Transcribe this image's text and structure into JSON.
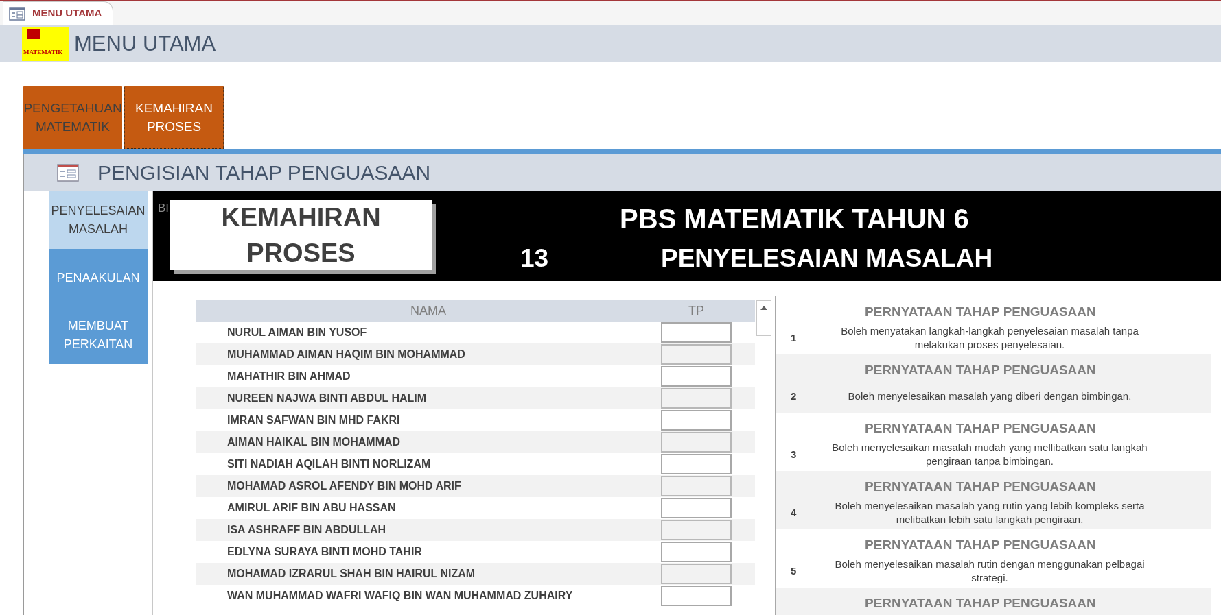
{
  "document_tab": {
    "title": "MENU UTAMA"
  },
  "header": {
    "logo_text": "MATEMATIK",
    "title": "MENU UTAMA"
  },
  "main_tabs": [
    {
      "label": "PENGETAHUAN MATEMATIK",
      "selected": false
    },
    {
      "label": "KEMAHIRAN PROSES",
      "selected": true
    }
  ],
  "section": {
    "title": "PENGISIAN TAHAP PENGUASAAN"
  },
  "sidebar": {
    "items": [
      {
        "label": "PENYELESAIAN MASALAH",
        "selected": true
      },
      {
        "label": "PENAAKULAN",
        "selected": false
      },
      {
        "label": "MEMBUAT PERKAITAN",
        "selected": false
      }
    ]
  },
  "banner": {
    "corner_text": "BI",
    "card_title": "KEMAHIRAN PROSES",
    "title": "PBS MATEMATIK TAHUN 6",
    "number": "13",
    "subtitle": "PENYELESAIAN MASALAH"
  },
  "table": {
    "columns": [
      "NAMA",
      "TP"
    ],
    "rows": [
      {
        "name": "NURUL AIMAN BIN YUSOF"
      },
      {
        "name": "MUHAMMAD AIMAN HAQIM BIN MOHAMMAD"
      },
      {
        "name": "MAHATHIR BIN AHMAD"
      },
      {
        "name": "NUREEN NAJWA BINTI ABDUL HALIM"
      },
      {
        "name": "IMRAN SAFWAN BIN MHD FAKRI"
      },
      {
        "name": "AIMAN HAIKAL BIN MOHAMMAD"
      },
      {
        "name": "SITI NADIAH AQILAH BINTI NORLIZAM"
      },
      {
        "name": "MOHAMAD ASROL AFENDY BIN MOHD ARIF"
      },
      {
        "name": "AMIRUL ARIF BIN ABU HASSAN"
      },
      {
        "name": "ISA ASHRAFF BIN ABDULLAH"
      },
      {
        "name": "EDLYNA SURAYA BINTI MOHD TAHIR"
      },
      {
        "name": "MOHAMAD IZRARUL SHAH BIN HAIRUL NIZAM"
      },
      {
        "name": "WAN MUHAMMAD WAFRI WAFIQ BIN WAN MUHAMMAD ZUHAIRY"
      }
    ]
  },
  "statements": [
    {
      "heading": "PERNYATAAN TAHAP PENGUASAAN",
      "number": "1",
      "text": "Boleh menyatakan langkah-langkah penyelesaian masalah tanpa melakukan proses penyelesaian."
    },
    {
      "heading": "PERNYATAAN TAHAP PENGUASAAN",
      "number": "2",
      "text": "Boleh menyelesaikan masalah yang diberi dengan bimbingan."
    },
    {
      "heading": "PERNYATAAN TAHAP PENGUASAAN",
      "number": "3",
      "text": "Boleh menyelesaikan masalah mudah yang mellibatkan satu langkah pengiraan tanpa bimbingan."
    },
    {
      "heading": "PERNYATAAN TAHAP PENGUASAAN",
      "number": "4",
      "text": "Boleh menyelesaikan masalah yang rutin yang lebih kompleks serta melibatkan lebih satu langkah pengiraan."
    },
    {
      "heading": "PERNYATAAN TAHAP PENGUASAAN",
      "number": "5",
      "text": "Boleh menyelesaikan masalah rutin dengan menggunakan pelbagai strategi."
    },
    {
      "heading": "PERNYATAAN TAHAP PENGUASAAN"
    }
  ]
}
